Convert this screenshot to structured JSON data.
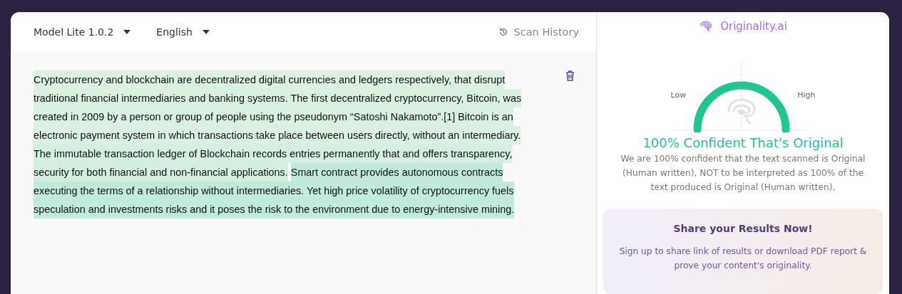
{
  "toolbar": {
    "model": "Model Lite 1.0.2",
    "language": "English",
    "history": "Scan History"
  },
  "text_lines": [
    {
      "segments": [
        {
          "text": "Cryptocurrency and blockchain are decentralized digital currencies and ledgers respectively, that disrupt",
          "color": "#daf0e0"
        }
      ]
    },
    {
      "segments": [
        {
          "text": "traditional financial intermediaries and banking systems. The first decentralized cryptocurrency, Bitcoin, was",
          "color": "#daf0e0"
        }
      ]
    },
    {
      "segments": [
        {
          "text": "created in 2009 by a person or group of people using the pseudonym “Satoshi Nakamoto”.[1] Bitcoin is an",
          "color": "#daf0e0"
        }
      ]
    },
    {
      "segments": [
        {
          "text": "electronic payment system in which transactions take place between users directly, without an intermediary.",
          "color": "#daf0e0"
        }
      ]
    },
    {
      "segments": [
        {
          "text": "The immutable transaction ledger of Blockchain records entries permanently that and offers transparency,",
          "color": "#d4efdf"
        }
      ]
    },
    {
      "segments": [
        {
          "text": "security for both financial and non-financial applications.",
          "color": "#d4efdf"
        },
        {
          "text": "Smart contract provides autonomous contracts",
          "color": "#bfeadc"
        }
      ]
    },
    {
      "segments": [
        {
          "text": "executing the terms of a relationship without intermediaries. Yet high price volatility of cryptocurrency fuels",
          "color": "#bfeadc"
        }
      ]
    },
    {
      "segments": [
        {
          "text": "speculation and investments risks and it poses the risk to the environment due to energy-intensive mining.",
          "color": "#bfeadc"
        }
      ]
    }
  ],
  "brand": "Originality.ai",
  "gauge": {
    "low": "Low",
    "high": "High"
  },
  "result_title": "100% Confident That's Original",
  "result_text": "We are 100% confident that the text scanned is Original (Human written), NOT to be interpreted as 100% of the text produced is Original (Human written).",
  "share": {
    "title": "Share your Results Now!",
    "text": "Sign up to share link of results or download PDF report & prove your content's originality."
  }
}
